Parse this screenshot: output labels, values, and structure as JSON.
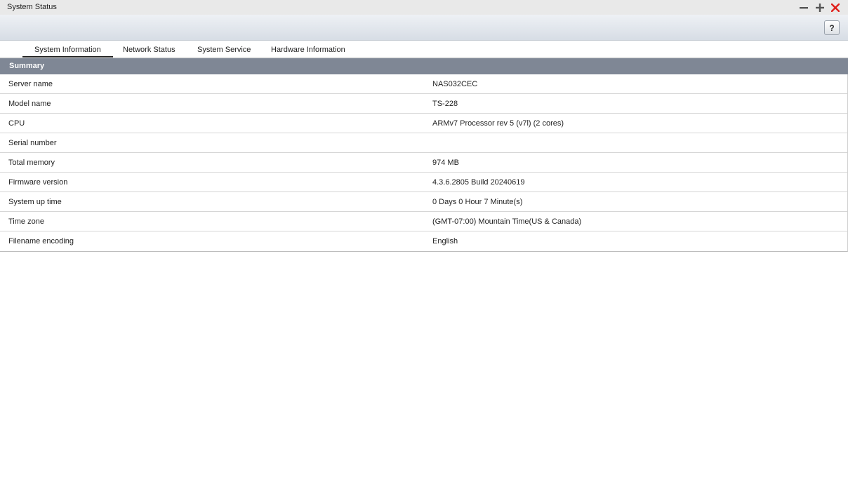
{
  "window": {
    "title": "System Status"
  },
  "toolbar": {
    "help_label": "?"
  },
  "tabs": [
    {
      "label": "System Information",
      "active": true
    },
    {
      "label": "Network Status",
      "active": false
    },
    {
      "label": "System Service",
      "active": false
    },
    {
      "label": "Hardware Information",
      "active": false
    }
  ],
  "summary": {
    "header": "Summary",
    "rows": [
      {
        "label": "Server name",
        "value": "NAS032CEC"
      },
      {
        "label": "Model name",
        "value": "TS-228"
      },
      {
        "label": "CPU",
        "value": "ARMv7 Processor rev 5 (v7l) (2 cores)"
      },
      {
        "label": "Serial number",
        "value": ""
      },
      {
        "label": "Total memory",
        "value": "974 MB"
      },
      {
        "label": "Firmware version",
        "value": "4.3.6.2805 Build 20240619"
      },
      {
        "label": "System up time",
        "value": "0 Days 0 Hour 7 Minute(s)"
      },
      {
        "label": "Time zone",
        "value": "(GMT-07:00) Mountain Time(US & Canada)"
      },
      {
        "label": "Filename encoding",
        "value": "English"
      }
    ]
  },
  "colors": {
    "summary_header_bg": "#7f8795",
    "close_icon": "#e0201c",
    "titlebar_bg": "#e9e9e9"
  },
  "icons": {
    "minimize": "minimize-icon",
    "maximize": "plus-icon",
    "close": "close-icon",
    "help": "help-icon"
  }
}
